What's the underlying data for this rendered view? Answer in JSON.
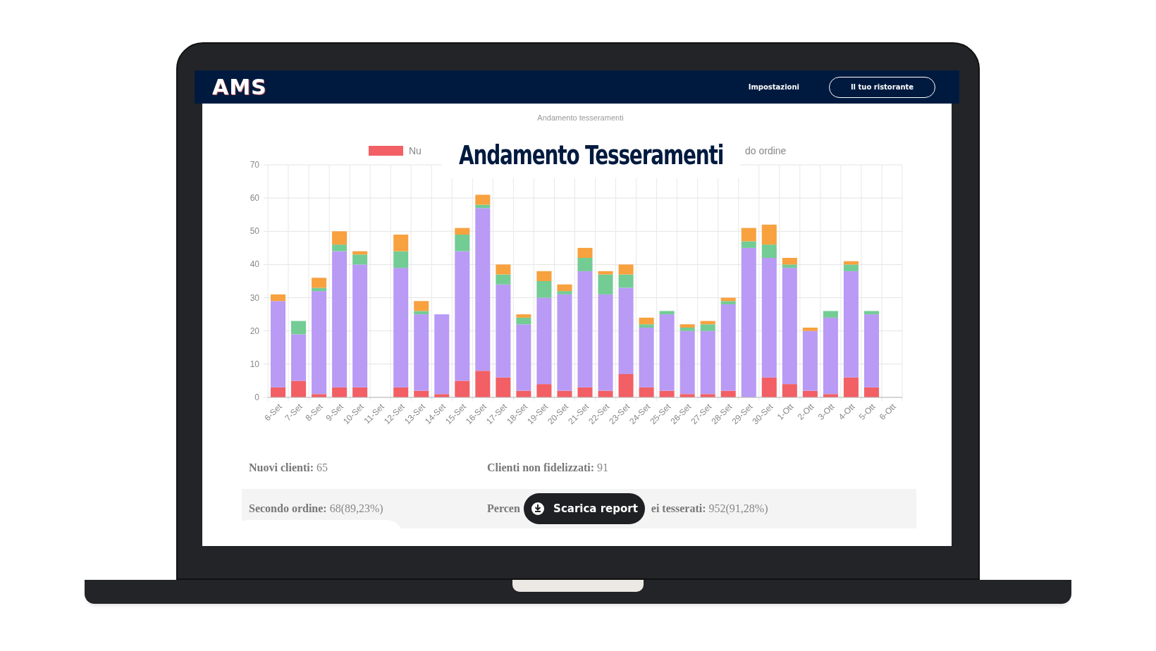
{
  "navbar": {
    "logo": "AMS",
    "links": [
      {
        "label": "Impostazioni",
        "kind": "link"
      },
      {
        "label": "Il tuo ristorante",
        "kind": "outlined"
      }
    ]
  },
  "overlay_title": "Andamento Tesseramenti",
  "chart_title": "Andamento tesseramenti",
  "legend": [
    {
      "label": "Nu",
      "color": "#f25f64"
    },
    {
      "label": "do ordine"
    }
  ],
  "chart_data": {
    "type": "bar",
    "stacked": true,
    "grid": true,
    "categories": [
      "6-Set",
      "7-Set",
      "8-Set",
      "9-Set",
      "10-Set",
      "11-Set",
      "12-Set",
      "13-Set",
      "14-Set",
      "15-Set",
      "16-Set",
      "17-Set",
      "18-Set",
      "19-Set",
      "20-Set",
      "21-Set",
      "22-Set",
      "23-Set",
      "24-Set",
      "25-Set",
      "26-Set",
      "27-Set",
      "28-Set",
      "29-Set",
      "30-Set",
      "1-Ott",
      "2-Ott",
      "3-Ott",
      "4-Ott",
      "5-Ott",
      "6-Ott"
    ],
    "ylim": [
      0,
      70
    ],
    "yticks": [
      0,
      10,
      20,
      30,
      40,
      50,
      60,
      70
    ],
    "series": [
      {
        "color": "#f25f64",
        "values": [
          3,
          5,
          1,
          3,
          3,
          0,
          3,
          2,
          1,
          5,
          8,
          6,
          2,
          4,
          2,
          3,
          2,
          7,
          3,
          2,
          1,
          1,
          2,
          0,
          6,
          4,
          2,
          1,
          6,
          3,
          0
        ]
      },
      {
        "color": "#b99af5",
        "values": [
          26,
          14,
          31,
          41,
          37,
          0,
          36,
          23,
          24,
          39,
          49,
          28,
          20,
          26,
          29,
          35,
          29,
          26,
          18,
          23,
          19,
          19,
          26,
          45,
          36,
          35,
          18,
          23,
          32,
          22,
          0
        ]
      },
      {
        "color": "#72cc94",
        "values": [
          0,
          4,
          1,
          2,
          3,
          0,
          5,
          1,
          0,
          5,
          1,
          3,
          2,
          5,
          1,
          4,
          6,
          4,
          1,
          1,
          1,
          2,
          1,
          2,
          4,
          1,
          0,
          2,
          2,
          1,
          0
        ]
      },
      {
        "color": "#f8a13f",
        "values": [
          2,
          0,
          3,
          4,
          1,
          0,
          5,
          3,
          0,
          2,
          3,
          3,
          1,
          3,
          2,
          3,
          1,
          3,
          2,
          0,
          1,
          1,
          1,
          4,
          6,
          2,
          1,
          0,
          1,
          0,
          0
        ]
      }
    ]
  },
  "stats": [
    [
      "**Nuovi clienti:** 65",
      "**Clienti non fidelizzati:** 91"
    ],
    [
      "**Secondo ordine:** 68(89,23%)",
      "**Percen**",
      "**ei tesserati:** 952(91,28%)"
    ]
  ],
  "download_button": {
    "label": "Scarica report"
  }
}
